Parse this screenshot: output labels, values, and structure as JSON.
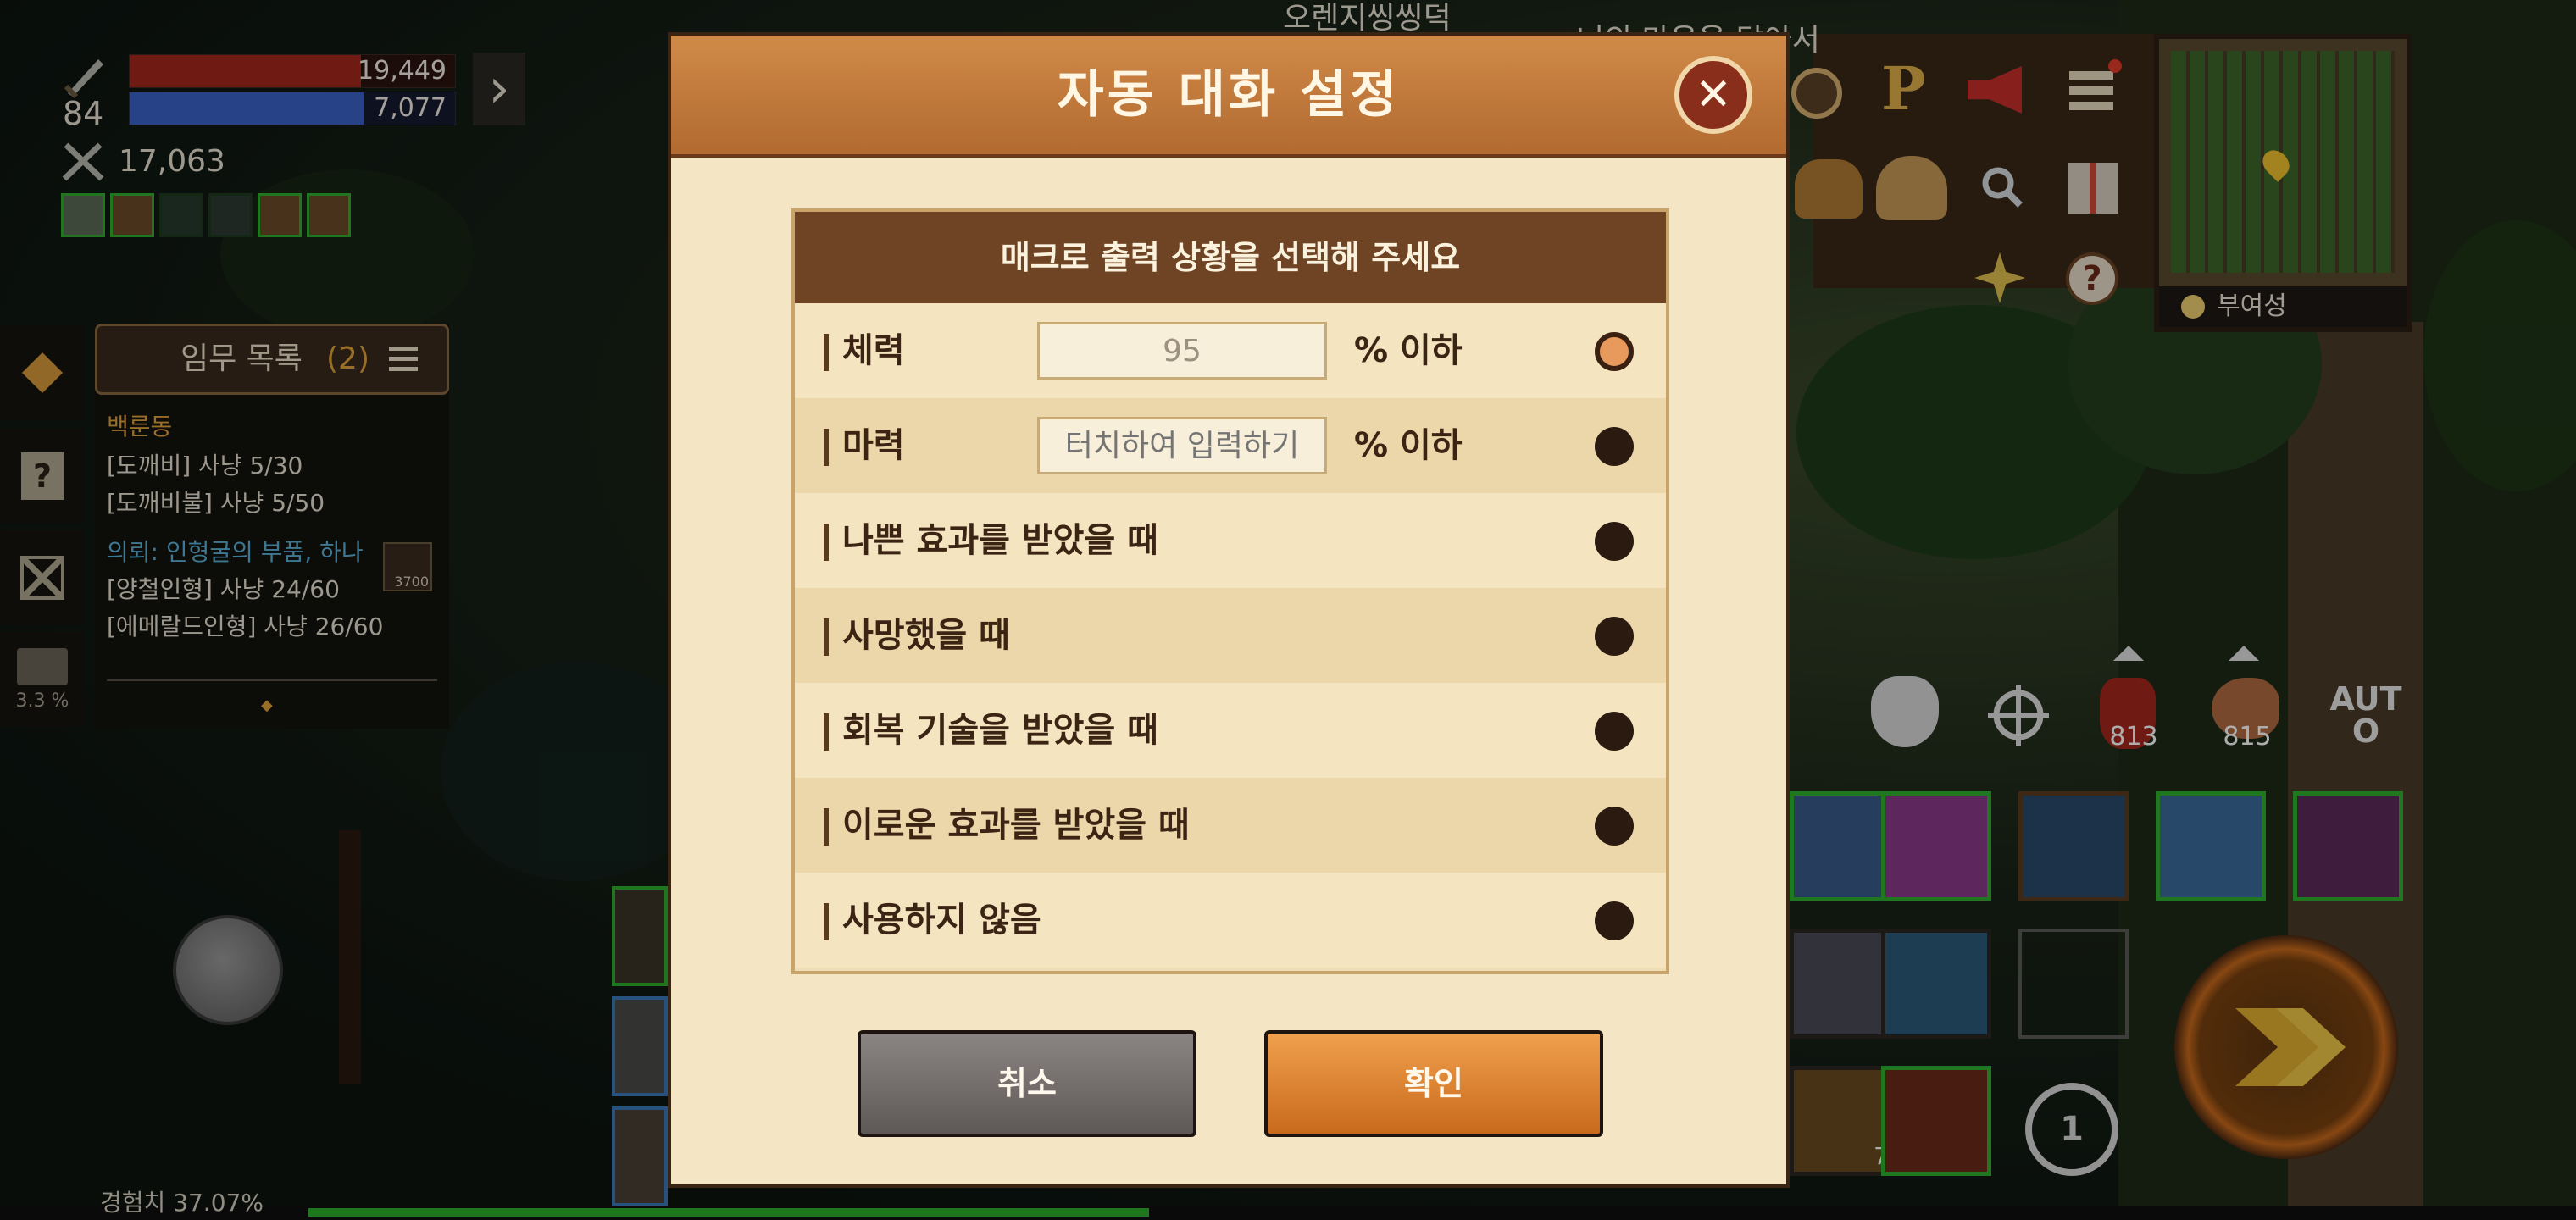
{
  "hud": {
    "level": "84",
    "hp_value": "19,449",
    "mp_value": "7,077",
    "hp_fill": 0.71,
    "mp_fill": 0.72,
    "combat_power": "17,063",
    "expand_arrow": "›",
    "exp_label": "경험치 37.07%",
    "exp_fill": 0.3707,
    "side_progress": "3.3 %"
  },
  "quest": {
    "title": "임무 목록",
    "count": "(2)",
    "entries": [
      {
        "heading": "백룬동",
        "lines": [
          "[도깨비] 사냥 5/30",
          "[도깨비불] 사냥 5/50"
        ]
      },
      {
        "heading": "의뢰: 인형굴의 부품, 하나",
        "lines": [
          "[양철인형] 사냥 24/60",
          "[에메랄드인형] 사냥 26/60"
        ],
        "reward": "3700"
      }
    ],
    "dot": "◆"
  },
  "scene_text": {
    "top_left": "오렌지씽씽덕",
    "top_right": "너의 마음을 담아서"
  },
  "minimap": {
    "location": "부여성"
  },
  "top_icons": {
    "p_label": "P"
  },
  "items": {
    "potion1_count": "813",
    "potion2_count": "815",
    "auto_label": "AUTO",
    "slot_count": "7",
    "swap_count": "1"
  },
  "dialog": {
    "title": "자동 대화 설정",
    "close_symbol": "✕",
    "section_title": "매크로 출력 상황을 선택해 주세요",
    "options": [
      {
        "label": "체력",
        "input_value": "95",
        "input_placeholder": "",
        "suffix": "% 이하",
        "selected": true
      },
      {
        "label": "마력",
        "input_value": "",
        "input_placeholder": "터치하여 입력하기",
        "suffix": "% 이하",
        "selected": false
      },
      {
        "label": "나쁜 효과를 받았을 때",
        "selected": false
      },
      {
        "label": "사망했을 때",
        "selected": false
      },
      {
        "label": "회복 기술을 받았을 때",
        "selected": false
      },
      {
        "label": "이로운 효과를 받았을 때",
        "selected": false
      },
      {
        "label": "사용하지 않음",
        "selected": false
      }
    ],
    "cancel_label": "취소",
    "confirm_label": "확인"
  },
  "colors": {
    "hp": "#a4281c",
    "mp": "#3a62c8",
    "accent": "#c86a1c",
    "header_brown": "#6e4424"
  }
}
